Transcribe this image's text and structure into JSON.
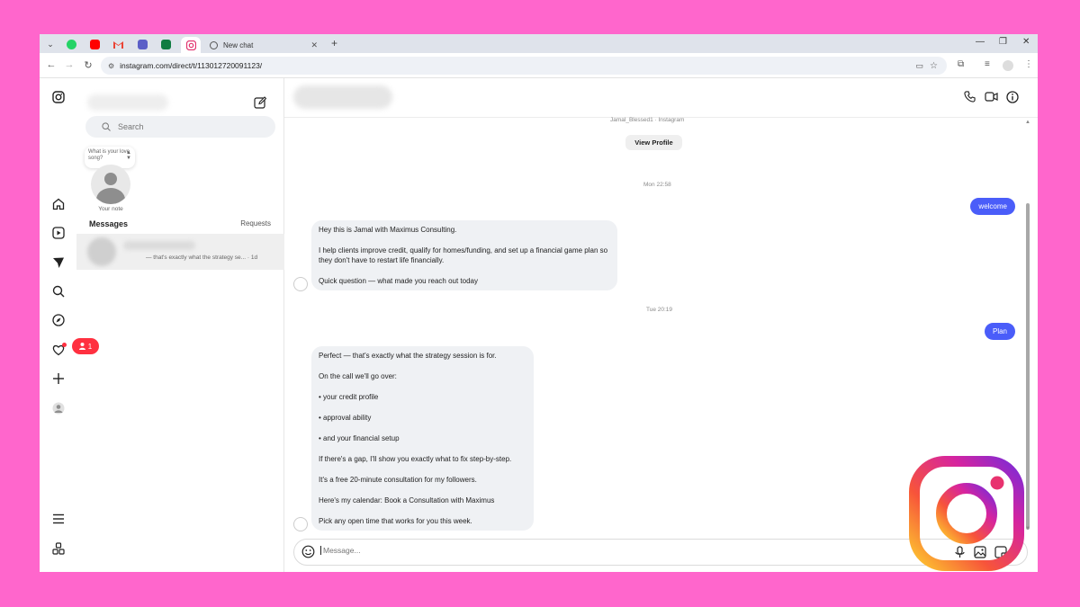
{
  "browser": {
    "tabs": [
      {
        "name": "whatsapp",
        "color": "#25d366"
      },
      {
        "name": "youtube",
        "color": "#ff0000"
      },
      {
        "name": "gmail",
        "color": "#ea4335"
      },
      {
        "name": "teams",
        "color": "#5b5fc7"
      },
      {
        "name": "excel",
        "color": "#107c41"
      },
      {
        "name": "instagram",
        "color": "#e1306c"
      }
    ],
    "new_tab_title": "New chat",
    "url": "instagram.com/direct/t/113012720091123/"
  },
  "sidebar": {
    "search_placeholder": "Search",
    "note_bubble_text": "What is your love song?",
    "your_note_label": "Your note",
    "messages_label": "Messages",
    "requests_label": "Requests",
    "notification_count": "1",
    "conversation_preview": "— that's exactly what the strategy se... · 1d"
  },
  "thread": {
    "profile_ref": "Jamal_Blessed1 · Instagram",
    "view_profile_label": "View Profile",
    "time1": "Mon 22:58",
    "out1": "welcome",
    "in1": [
      "Hey this is Jamal with Maximus Consulting.",
      "I help clients improve credit, qualify for homes/funding, and set up a financial game plan so they don't have to restart life financially.",
      "Quick question — what made you reach out today"
    ],
    "time2": "Tue 20:19",
    "out2": "Plan",
    "in2": [
      "Perfect — that's exactly what the strategy session is for.",
      "On the call we'll go over:",
      "• your credit profile",
      "• approval ability",
      "• and your financial setup",
      "If there's a gap, I'll show you exactly what to fix step-by-step.",
      " It's a free 20-minute consultation for my followers.",
      "Here's my calendar: Book a Consultation with Maximus",
      "Pick any open time that works for you this week."
    ],
    "composer_placeholder": "Message..."
  },
  "colors": {
    "background": "#ff66cc",
    "outgoing_bubble": "#4a5df9",
    "incoming_bubble": "#eff1f4",
    "notification": "#ff3040"
  }
}
